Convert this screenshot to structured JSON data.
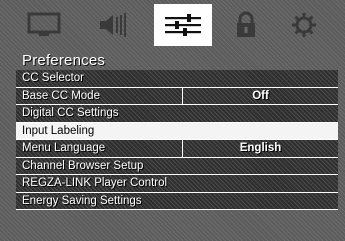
{
  "tabs": [
    {
      "icon": "picture-icon",
      "selected": false
    },
    {
      "icon": "sound-icon",
      "selected": false
    },
    {
      "icon": "settings-sliders-icon",
      "selected": true
    },
    {
      "icon": "lock-icon",
      "selected": false
    },
    {
      "icon": "gear-icon",
      "selected": false
    }
  ],
  "menu": {
    "title": "Preferences",
    "items": [
      {
        "label": "CC Selector",
        "value": ""
      },
      {
        "label": "Base CC Mode",
        "value": "Off"
      },
      {
        "label": "Digital CC Settings",
        "value": ""
      },
      {
        "label": "Input Labeling",
        "value": "",
        "highlighted": true
      },
      {
        "label": "Menu Language",
        "value": "English"
      },
      {
        "label": "Channel Browser Setup",
        "value": ""
      },
      {
        "label": "REGZA-LINK Player Control",
        "value": ""
      },
      {
        "label": "Energy Saving Settings",
        "value": ""
      }
    ]
  },
  "colors": {
    "background": "#5c5c5c",
    "row": "#2e2e2e",
    "highlight": "#f4f4f4",
    "text": "#ffffff"
  }
}
